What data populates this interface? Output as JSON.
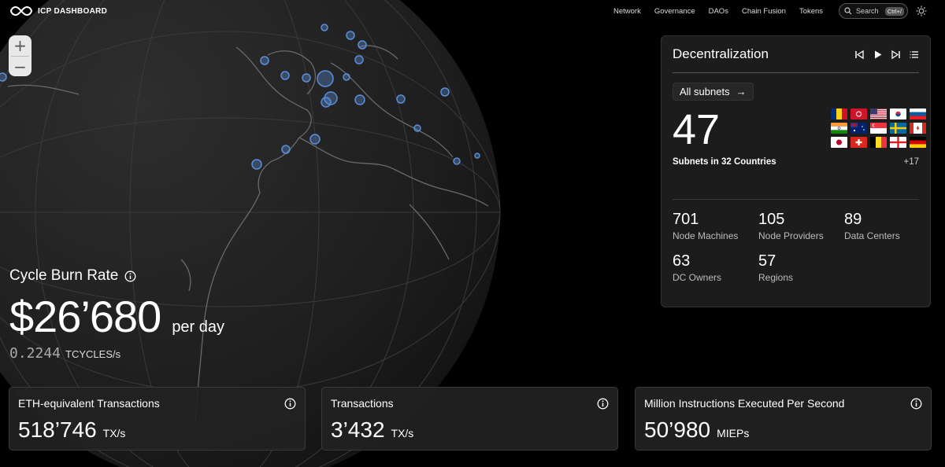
{
  "brand": {
    "name": "ICP DASHBOARD",
    "logo_icon": "infinity-icon"
  },
  "nav": {
    "items": [
      "Network",
      "Governance",
      "DAOs",
      "Chain Fusion",
      "Tokens"
    ]
  },
  "search": {
    "label": "Search",
    "shortcut": "Ctrl+/"
  },
  "zoom": {
    "in": "+",
    "out": "−"
  },
  "burn": {
    "title": "Cycle Burn Rate",
    "value": "$26’680",
    "unit": "per day",
    "rate": "0.2244",
    "rate_unit": "TCYCLES/s"
  },
  "cards": [
    {
      "title": "ETH-equivalent Transactions",
      "value": "518’746",
      "unit": "TX/s"
    },
    {
      "title": "Transactions",
      "value": "3’432",
      "unit": "TX/s"
    },
    {
      "title": "Million Instructions Executed Per Second",
      "value": "50’980",
      "unit": "MIEPs"
    }
  ],
  "panel": {
    "title": "Decentralization",
    "subnets_button": "All subnets",
    "arrow": "→",
    "count": "47",
    "countries_text": "Subnets in 32 Countries",
    "more_flags": "+17",
    "stats": [
      {
        "value": "701",
        "label": "Node Machines"
      },
      {
        "value": "105",
        "label": "Node Providers"
      },
      {
        "value": "89",
        "label": "Data Centers"
      },
      {
        "value": "63",
        "label": "DC Owners"
      },
      {
        "value": "57",
        "label": "Regions"
      }
    ]
  },
  "colors": {
    "accent": "#5b8fd9",
    "card_bg": "#222222",
    "panel_bg": "#1c1c1c"
  }
}
